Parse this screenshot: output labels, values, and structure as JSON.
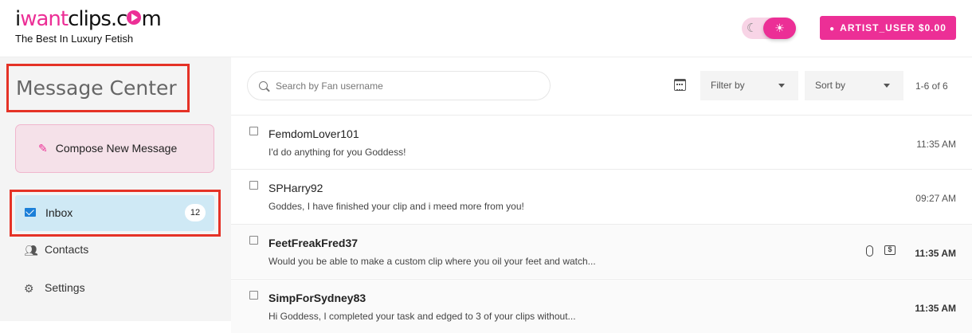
{
  "header": {
    "logo": {
      "part1": "i",
      "part2": "want",
      "part3": "clips.c",
      "part4": "m"
    },
    "tagline": "The Best In Luxury Fetish",
    "theme_toggle": {
      "moon_icon": "moon-icon",
      "sun_icon": "sun-icon",
      "active": "light"
    },
    "user_button": "ARTIST_USER $0.00"
  },
  "sidebar": {
    "title": "Message Center",
    "compose_label": "Compose New Message",
    "inbox": {
      "label": "Inbox",
      "count": "12"
    },
    "contacts_label": "Contacts",
    "settings_label": "Settings"
  },
  "toolbar": {
    "search_placeholder": "Search by Fan username",
    "filter_label": "Filter by",
    "sort_label": "Sort by",
    "range_text": "1-6 of 6"
  },
  "messages": [
    {
      "sender": "FemdomLover101",
      "preview": "I'd do anything for you Goddess!",
      "time": "11:35 AM"
    },
    {
      "sender": "SPHarry92",
      "preview": "Goddes, I have finished your clip and i meed more from you!",
      "time": "09:27 AM"
    },
    {
      "sender": "FeetFreakFred37",
      "preview": "Would you be able to make a custom clip where you oil your feet and watch...",
      "time": "11:35 AM"
    },
    {
      "sender": "SimpForSydney83",
      "preview": "Hi Goddess, I completed your task and edged to 3 of your clips without...",
      "time": "11:35 AM"
    }
  ],
  "colors": {
    "accent": "#ec2f96",
    "highlight": "#e53226",
    "inbox_bg": "#cfe9f5"
  }
}
